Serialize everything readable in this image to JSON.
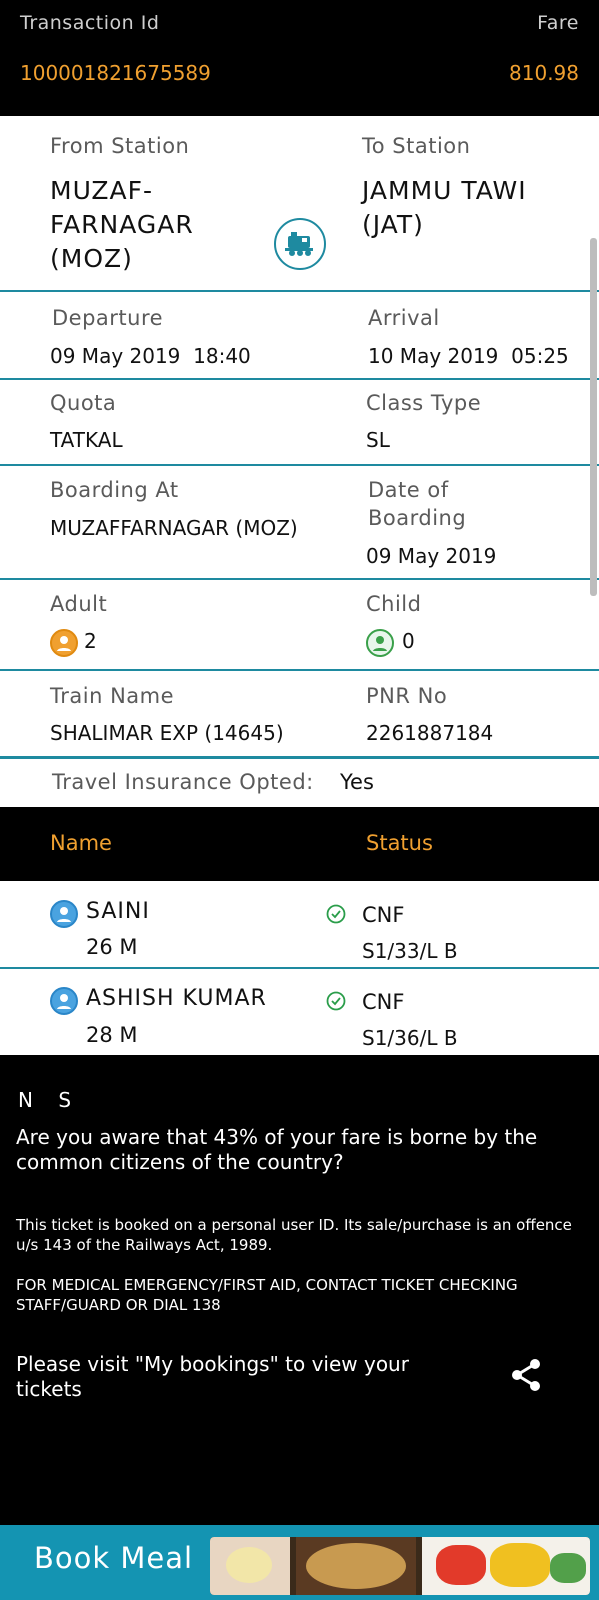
{
  "header": {
    "transaction_label": "Transaction Id",
    "fare_label": "Fare",
    "transaction_id": "100001821675589",
    "fare": "810.98"
  },
  "journey": {
    "from_label": "From Station",
    "from_value": "MUZAF-\nFARNAGAR\n(MOZ)",
    "to_label": "To Station",
    "to_value": "JAMMU TAWI\n(JAT)",
    "departure_label": "Departure",
    "departure_date": "09 May 2019",
    "departure_time": "18:40",
    "arrival_label": "Arrival",
    "arrival_date": "10 May 2019",
    "arrival_time": "05:25",
    "quota_label": "Quota",
    "quota_value": "TATKAL",
    "class_label": "Class Type",
    "class_value": "SL",
    "boarding_label": "Boarding At",
    "boarding_value": "MUZAFFARNAGAR (MOZ)",
    "dob_label": "Date of\nBoarding",
    "dob_value": "09 May 2019",
    "adult_label": "Adult",
    "adult_value": "2",
    "child_label": "Child",
    "child_value": "0",
    "train_label": "Train Name",
    "train_value": "SHALIMAR EXP (14645)",
    "pnr_label": "PNR No",
    "pnr_value": "2261887184",
    "insurance_label": "Travel Insurance Opted:",
    "insurance_value": "Yes"
  },
  "passenger_header": {
    "name": "Name",
    "status": "Status"
  },
  "passengers": [
    {
      "name": "SAINI",
      "age_gender": "26 M",
      "status": "CNF",
      "berth": "S1/33/L B"
    },
    {
      "name": "ASHISH KUMAR",
      "age_gender": "28 M",
      "status": "CNF",
      "berth": "S1/36/L B"
    }
  ],
  "notes": {
    "ns": "N    S",
    "awareness": "Are you aware that 43% of your fare is borne by the common citizens of the country?",
    "personal": "This ticket is booked on a personal user ID. Its sale/purchase is an offence u/s 143 of the Railways Act, 1989.",
    "medical": "FOR MEDICAL EMERGENCY/FIRST AID, CONTACT TICKET CHECKING STAFF/GUARD OR DIAL 138",
    "visit": "Please visit \"My bookings\" to view your tickets"
  },
  "meal": {
    "label": "Book Meal"
  },
  "icons": {
    "train": "train-icon",
    "adult": "adult-icon",
    "child": "child-icon",
    "check": "check-circle-icon",
    "share": "share-icon",
    "person": "person-icon"
  },
  "colors": {
    "accent": "#1e8aa0",
    "orange": "#f0a030",
    "green": "#2a9d4a",
    "meal_bar": "#1494b2"
  }
}
